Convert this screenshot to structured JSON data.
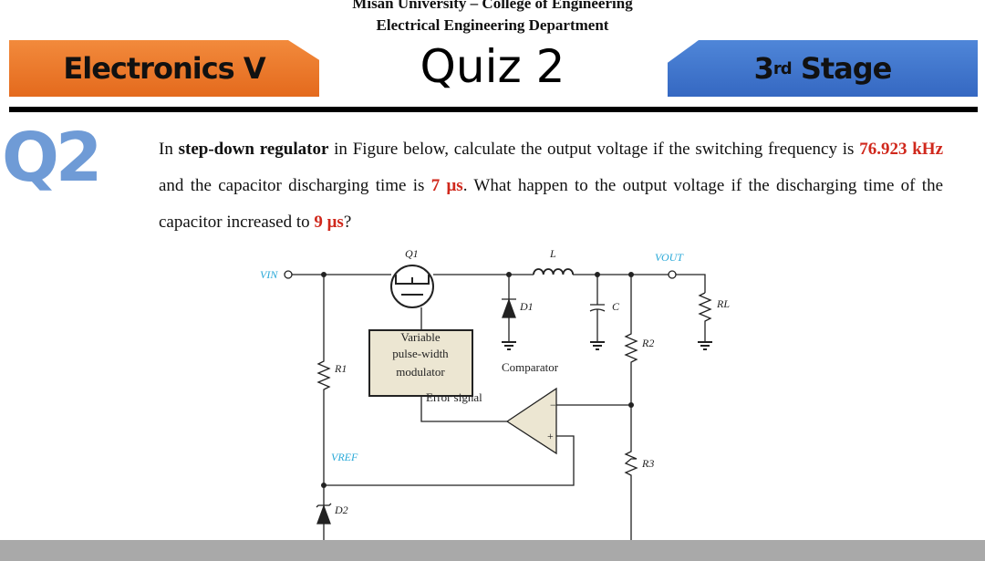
{
  "header": {
    "university": "Misan University – College of Engineering",
    "department": "Electrical  Engineering Department"
  },
  "banners": {
    "course": "Electronics V",
    "quiz": "Quiz 2",
    "stage_num": "3",
    "stage_sup": "rd",
    "stage_word": "Stage"
  },
  "question": {
    "label": "Q2",
    "t1": "In ",
    "t2": "step-down regulator",
    "t3": " in Figure below, calculate the output voltage if the switching frequency is ",
    "freq": "76.923 kHz",
    "t4": " and the capacitor discharging time is ",
    "t_dis": "7 μs",
    "t5": ". What happen to the output voltage if the discharging time of the capacitor increased to ",
    "t_new": "9 μs",
    "t6": "?"
  },
  "figure": {
    "q1": "Q1",
    "l": "L",
    "vout": "VOUT",
    "vin": "VIN",
    "d1": "D1",
    "c": "C",
    "rl": "RL",
    "r2": "R2",
    "r1": "R1",
    "r3": "R3",
    "vref": "VREF",
    "d2": "D2",
    "pwm": [
      "Variable",
      "pulse-width",
      "modulator"
    ],
    "comparator": "Comparator",
    "error": "Error signal",
    "minus": "−",
    "plus": "+"
  },
  "colors": {
    "orange": "#e97b2b",
    "blue": "#3f74cc",
    "highlight": "#d0281c",
    "label_cyan": "#2aa9d8"
  }
}
